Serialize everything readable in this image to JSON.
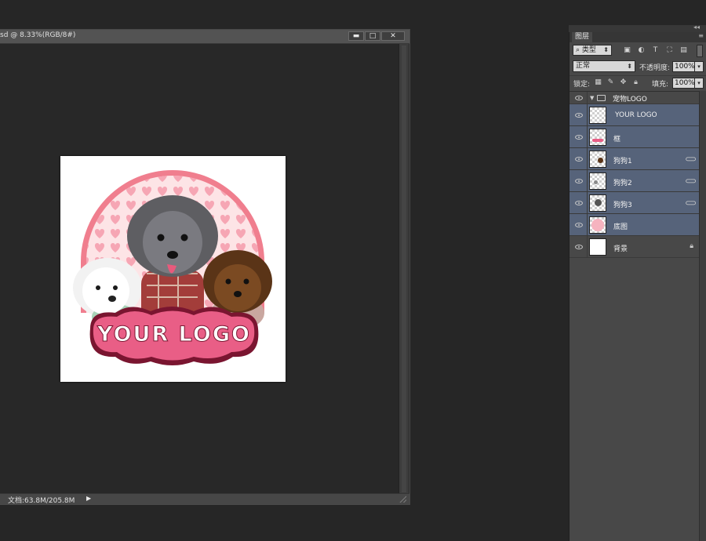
{
  "document": {
    "title": "sd @ 8.33%(RGB/8#)",
    "status": "文档:63.8M/205.8M",
    "status_arrow_icon": "play-arrow-icon"
  },
  "window_controls": {
    "minimize": "▬",
    "maximize": "□",
    "close": "✕"
  },
  "artwork": {
    "logo_text": "YOUR LOGO",
    "colors": {
      "arch": "#f07e8e",
      "arch_inner": "#fde4e6",
      "heart": "#f6a6b4",
      "banner": "#e95e86",
      "banner_outline": "#7a1530",
      "text": "#ffffff"
    }
  },
  "layers_panel": {
    "tab": "图层",
    "filter_label": "类型",
    "blend_mode": "正常",
    "opacity_label": "不透明度:",
    "opacity_value": "100%",
    "lock_label": "锁定:",
    "fill_label": "填充:",
    "fill_value": "100%",
    "group": {
      "name": "宠物LOGO"
    },
    "layers": [
      {
        "name": "YOUR LOGO",
        "type": "text",
        "selected": true
      },
      {
        "name": "框",
        "type": "pixel",
        "selected": true,
        "linked": false
      },
      {
        "name": "狗狗1",
        "type": "pixel",
        "selected": true,
        "linked": true
      },
      {
        "name": "狗狗2",
        "type": "pixel",
        "selected": true,
        "linked": true
      },
      {
        "name": "狗狗3",
        "type": "pixel",
        "selected": true,
        "linked": true
      },
      {
        "name": "底图",
        "type": "pixel",
        "selected": true,
        "linked": false
      },
      {
        "name": "背景",
        "type": "background",
        "selected": false,
        "locked": true
      }
    ],
    "link_glyph": "⊂⊃",
    "lock_glyph": "🔒",
    "accent_selected": "#56637a"
  }
}
